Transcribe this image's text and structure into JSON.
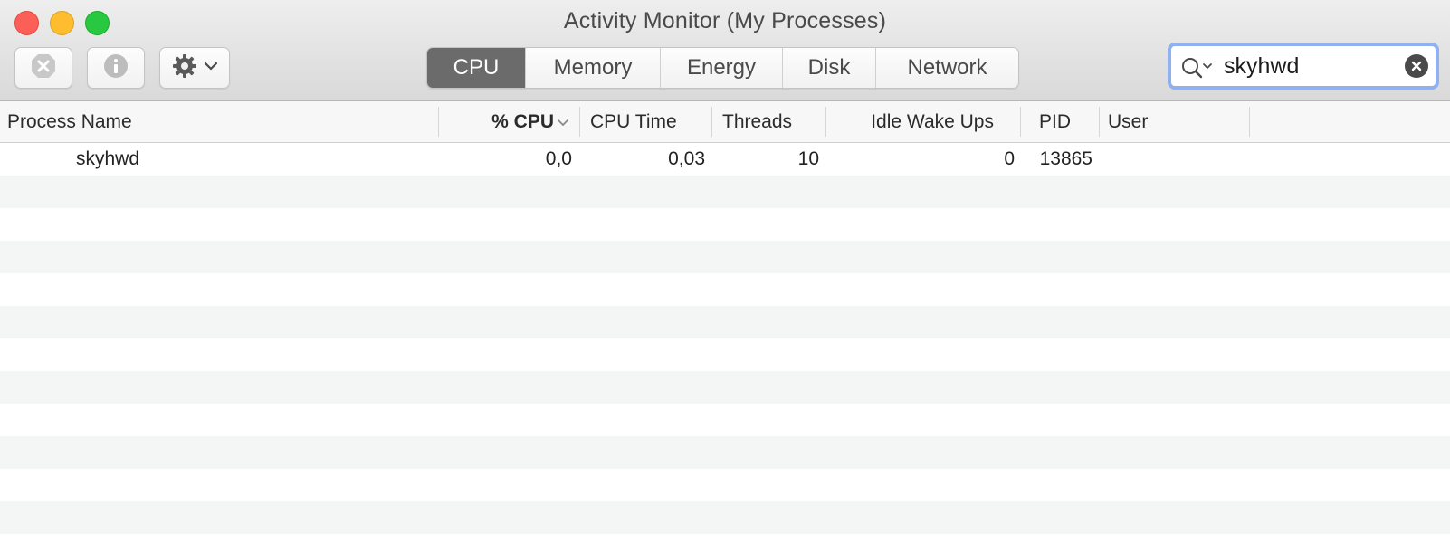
{
  "window": {
    "title": "Activity Monitor (My Processes)"
  },
  "toolbar": {
    "tabs": [
      {
        "label": "CPU",
        "active": true
      },
      {
        "label": "Memory",
        "active": false
      },
      {
        "label": "Energy",
        "active": false
      },
      {
        "label": "Disk",
        "active": false
      },
      {
        "label": "Network",
        "active": false
      }
    ],
    "search_value": "skyhwd"
  },
  "table": {
    "columns": [
      "Process Name",
      "% CPU",
      "CPU Time",
      "Threads",
      "Idle Wake Ups",
      "PID",
      "User"
    ],
    "sort_column": "% CPU",
    "rows": [
      {
        "process_name": "skyhwd",
        "cpu_percent": "0,0",
        "cpu_time": "0,03",
        "threads": "10",
        "idle_wake_ups": "0",
        "pid": "13865",
        "user": ""
      }
    ]
  },
  "colors": {
    "active_tab": "#6b6b6b",
    "search_focus": "#8fb1ef",
    "row_stripe": "#f4f5f5"
  }
}
